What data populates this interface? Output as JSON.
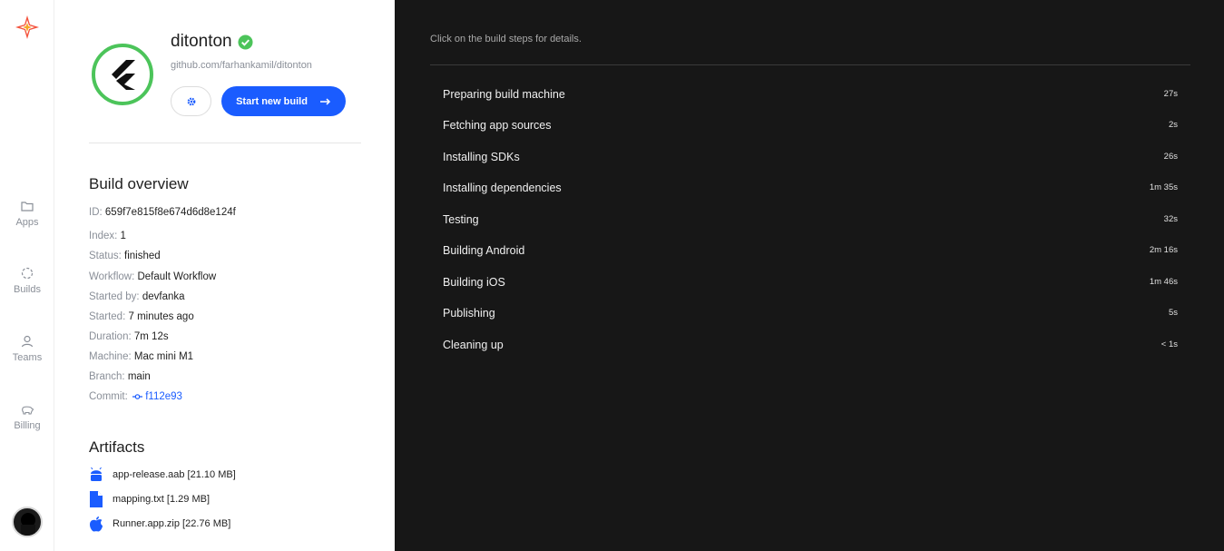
{
  "nav": {
    "items": [
      {
        "label": "Apps",
        "icon": "folder-icon"
      },
      {
        "label": "Builds",
        "icon": "builds-icon"
      },
      {
        "label": "Teams",
        "icon": "user-icon"
      },
      {
        "label": "Billing",
        "icon": "piggy-bank-icon"
      }
    ]
  },
  "app": {
    "name": "ditonton",
    "repo": "github.com/farhankamil/ditonton",
    "start_build_label": "Start new build"
  },
  "overview": {
    "title": "Build overview",
    "rows": [
      {
        "key": "ID:",
        "value": "659f7e815f8e674d6d8e124f"
      },
      {
        "key": "Index:",
        "value": "1"
      },
      {
        "key": "Status:",
        "value": "finished"
      },
      {
        "key": "Workflow:",
        "value": "Default Workflow"
      },
      {
        "key": "Started by:",
        "value": "devfanka"
      },
      {
        "key": "Started:",
        "value": "7 minutes ago"
      },
      {
        "key": "Duration:",
        "value": "7m 12s"
      },
      {
        "key": "Machine:",
        "value": "Mac mini M1"
      },
      {
        "key": "Branch:",
        "value": "main"
      },
      {
        "key": "Commit:",
        "value": "f112e93"
      }
    ]
  },
  "artifacts": {
    "title": "Artifacts",
    "items": [
      {
        "label": "app-release.aab [21.10 MB]",
        "icon": "android-icon"
      },
      {
        "label": "mapping.txt [1.29 MB]",
        "icon": "file-icon"
      },
      {
        "label": "Runner.app.zip [22.76 MB]",
        "icon": "apple-icon"
      }
    ]
  },
  "steps": {
    "hint": "Click on the build steps for details.",
    "items": [
      {
        "name": "Preparing build machine",
        "duration": "27s"
      },
      {
        "name": "Fetching app sources",
        "duration": "2s"
      },
      {
        "name": "Installing SDKs",
        "duration": "26s"
      },
      {
        "name": "Installing dependencies",
        "duration": "1m 35s"
      },
      {
        "name": "Testing",
        "duration": "32s"
      },
      {
        "name": "Building Android",
        "duration": "2m 16s"
      },
      {
        "name": "Building iOS",
        "duration": "1m 46s"
      },
      {
        "name": "Publishing",
        "duration": "5s"
      },
      {
        "name": "Cleaning up",
        "duration": "< 1s"
      }
    ]
  },
  "colors": {
    "accent": "#1a5cff",
    "success": "#4cc45a",
    "dark_bg": "#171717"
  }
}
